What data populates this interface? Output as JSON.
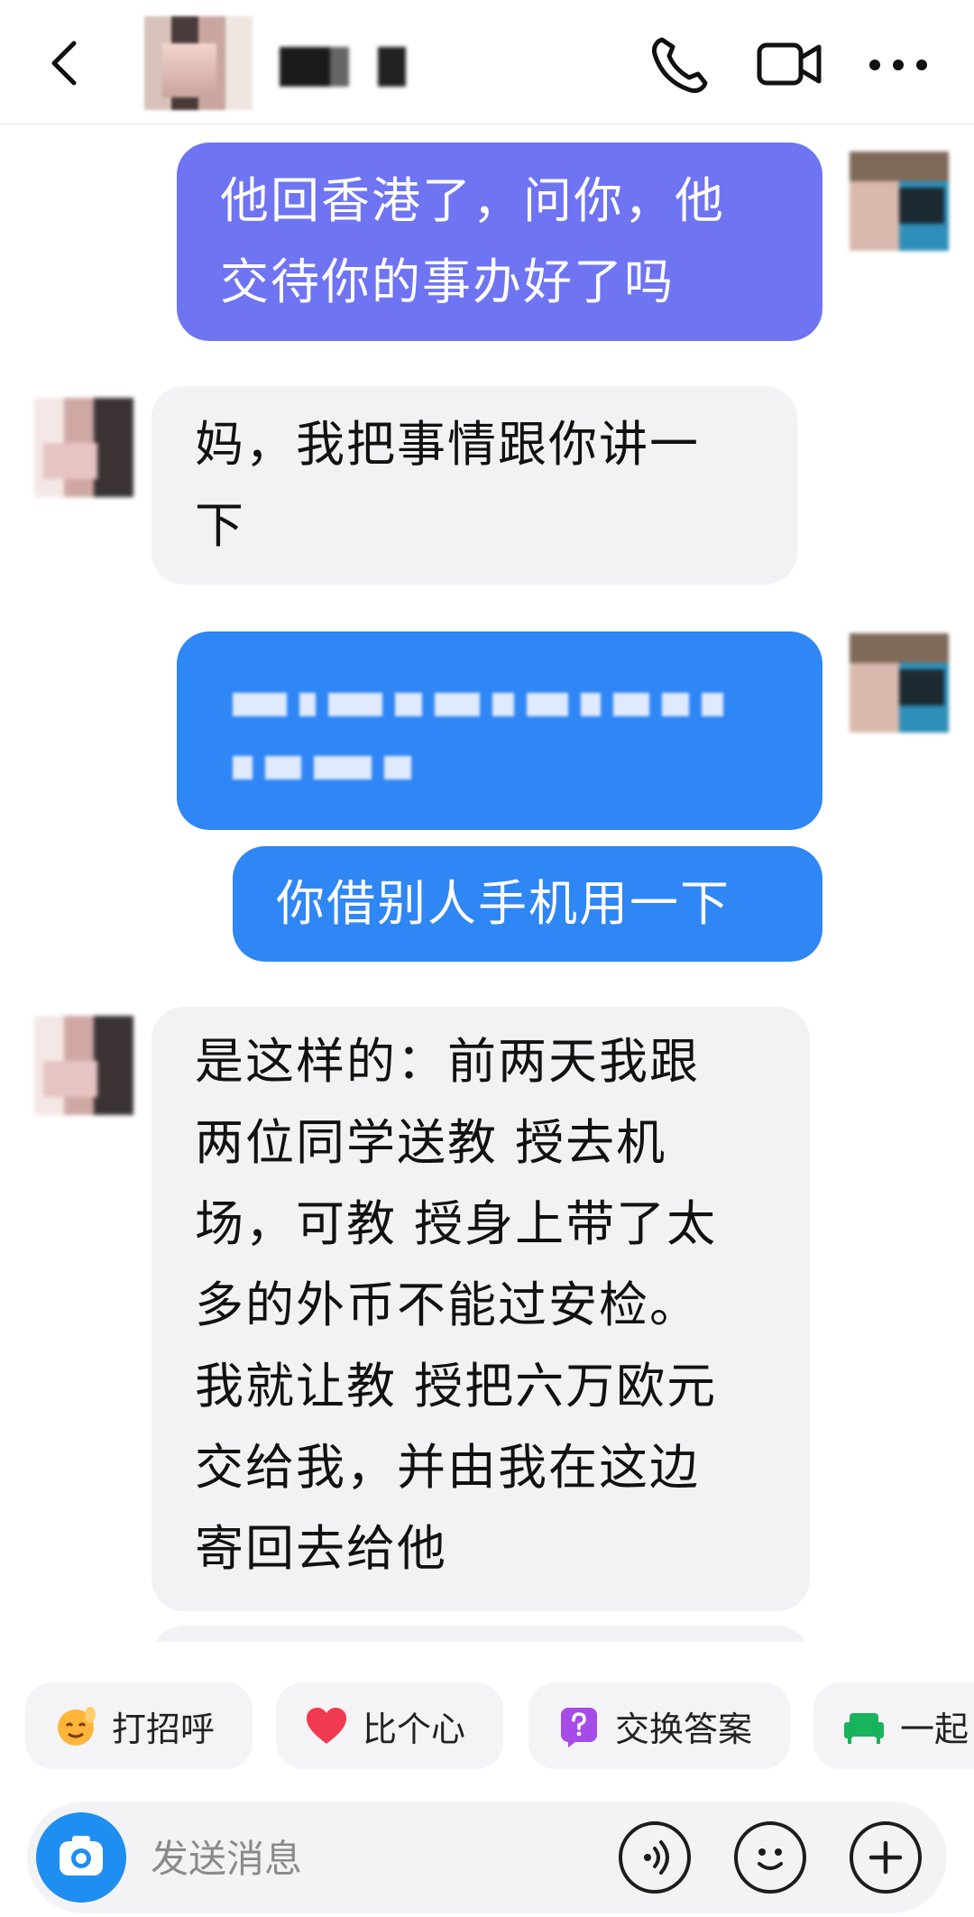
{
  "header": {
    "contact_name": "■■ ■",
    "icons": [
      "back-icon",
      "phone-icon",
      "video-call-icon",
      "more-icon"
    ]
  },
  "messages": [
    {
      "side": "me",
      "color": "#6f74f2",
      "lines": [
        "他回香港了，问你，他",
        "交待你的事办好了吗"
      ]
    },
    {
      "side": "them",
      "lines": [
        "妈，我把事情跟你讲一",
        "下"
      ]
    },
    {
      "side": "me",
      "color": "#2f86f5",
      "lines": [
        "(pixelated)"
      ]
    },
    {
      "side": "me",
      "color": "#2f86f5",
      "lines": [
        "你借别人手机用一下"
      ]
    },
    {
      "side": "them",
      "lines": [
        "是这样的：前两天我跟",
        "两位同学送教 授去机",
        "场，可教 授身上带了太",
        "多的外币不能过安检。",
        "我就让教 授把六万欧元",
        "交给我，并由我在这边",
        "寄回去给他"
      ]
    }
  ],
  "quick_replies": [
    {
      "label": "打招呼",
      "icon": "wave-icon"
    },
    {
      "label": "比个心",
      "icon": "heart-icon"
    },
    {
      "label": "交换答案",
      "icon": "question-icon"
    },
    {
      "label": "一起",
      "icon": "sofa-icon"
    }
  ],
  "input": {
    "placeholder": "发送消息",
    "icons": [
      "camera-icon",
      "voice-icon",
      "emoji-icon",
      "plus-icon"
    ]
  },
  "colors": {
    "accent_blue": "#2f86f5",
    "purple": "#6f74f2",
    "incoming": "#f2f2f4"
  }
}
